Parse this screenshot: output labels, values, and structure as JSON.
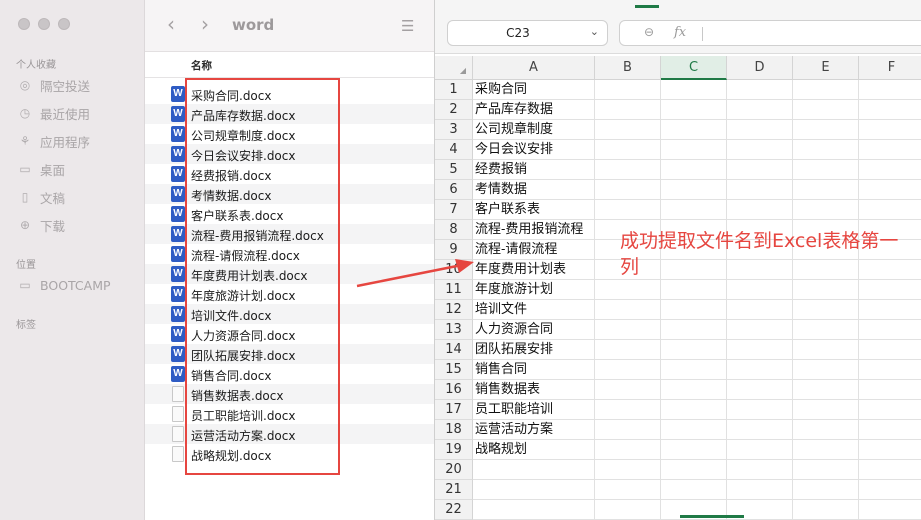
{
  "finder": {
    "window_title": "word",
    "sidebar": {
      "favorites_label": "个人收藏",
      "favorites": [
        {
          "label": "隔空投送",
          "icon": "airdrop-icon"
        },
        {
          "label": "最近使用",
          "icon": "clock-icon"
        },
        {
          "label": "应用程序",
          "icon": "applications-icon"
        },
        {
          "label": "桌面",
          "icon": "desktop-icon"
        },
        {
          "label": "文稿",
          "icon": "document-icon"
        },
        {
          "label": "下载",
          "icon": "download-icon"
        }
      ],
      "locations_label": "位置",
      "locations": [
        {
          "label": "BOOTCAMP",
          "icon": "disk-icon"
        }
      ],
      "tags_label": "标签"
    },
    "column_name": "名称",
    "files": [
      {
        "name": "采购合同.docx",
        "type": "word"
      },
      {
        "name": "产品库存数据.docx",
        "type": "word"
      },
      {
        "name": "公司规章制度.docx",
        "type": "word"
      },
      {
        "name": "今日会议安排.docx",
        "type": "word"
      },
      {
        "name": "经费报销.docx",
        "type": "word"
      },
      {
        "name": "考情数据.docx",
        "type": "word"
      },
      {
        "name": "客户联系表.docx",
        "type": "word"
      },
      {
        "name": "流程-费用报销流程.docx",
        "type": "word"
      },
      {
        "name": "流程-请假流程.docx",
        "type": "word"
      },
      {
        "name": "年度费用计划表.docx",
        "type": "word"
      },
      {
        "name": "年度旅游计划.docx",
        "type": "word"
      },
      {
        "name": "培训文件.docx",
        "type": "word"
      },
      {
        "name": "人力资源合同.docx",
        "type": "word"
      },
      {
        "name": "团队拓展安排.docx",
        "type": "word"
      },
      {
        "name": "销售合同.docx",
        "type": "word"
      },
      {
        "name": "销售数据表.docx",
        "type": "blank"
      },
      {
        "name": "员工职能培训.docx",
        "type": "blank"
      },
      {
        "name": "运营活动方案.docx",
        "type": "blank"
      },
      {
        "name": "战略规划.docx",
        "type": "blank"
      }
    ]
  },
  "excel": {
    "name_box": "C23",
    "fx_label": "fx",
    "columns": [
      "A",
      "B",
      "C",
      "D",
      "E",
      "F"
    ],
    "selected_column": "C",
    "rows": [
      {
        "num": "1",
        "a": "采购合同"
      },
      {
        "num": "2",
        "a": "产品库存数据"
      },
      {
        "num": "3",
        "a": "公司规章制度"
      },
      {
        "num": "4",
        "a": "今日会议安排"
      },
      {
        "num": "5",
        "a": "经费报销"
      },
      {
        "num": "6",
        "a": "考情数据"
      },
      {
        "num": "7",
        "a": "客户联系表"
      },
      {
        "num": "8",
        "a": "流程-费用报销流程"
      },
      {
        "num": "9",
        "a": "流程-请假流程"
      },
      {
        "num": "10",
        "a": "年度费用计划表"
      },
      {
        "num": "11",
        "a": "年度旅游计划"
      },
      {
        "num": "12",
        "a": "培训文件"
      },
      {
        "num": "13",
        "a": "人力资源合同"
      },
      {
        "num": "14",
        "a": "团队拓展安排"
      },
      {
        "num": "15",
        "a": "销售合同"
      },
      {
        "num": "16",
        "a": "销售数据表"
      },
      {
        "num": "17",
        "a": "员工职能培训"
      },
      {
        "num": "18",
        "a": "运营活动方案"
      },
      {
        "num": "19",
        "a": "战略规划"
      },
      {
        "num": "20",
        "a": ""
      },
      {
        "num": "21",
        "a": ""
      },
      {
        "num": "22",
        "a": ""
      }
    ]
  },
  "annotation": {
    "text": "成功提取文件名到Excel表格第一列",
    "color": "#e64640"
  },
  "colors": {
    "accent_red": "#e64640",
    "excel_green": "#1f7a46",
    "word_blue": "#2f5cc4"
  }
}
